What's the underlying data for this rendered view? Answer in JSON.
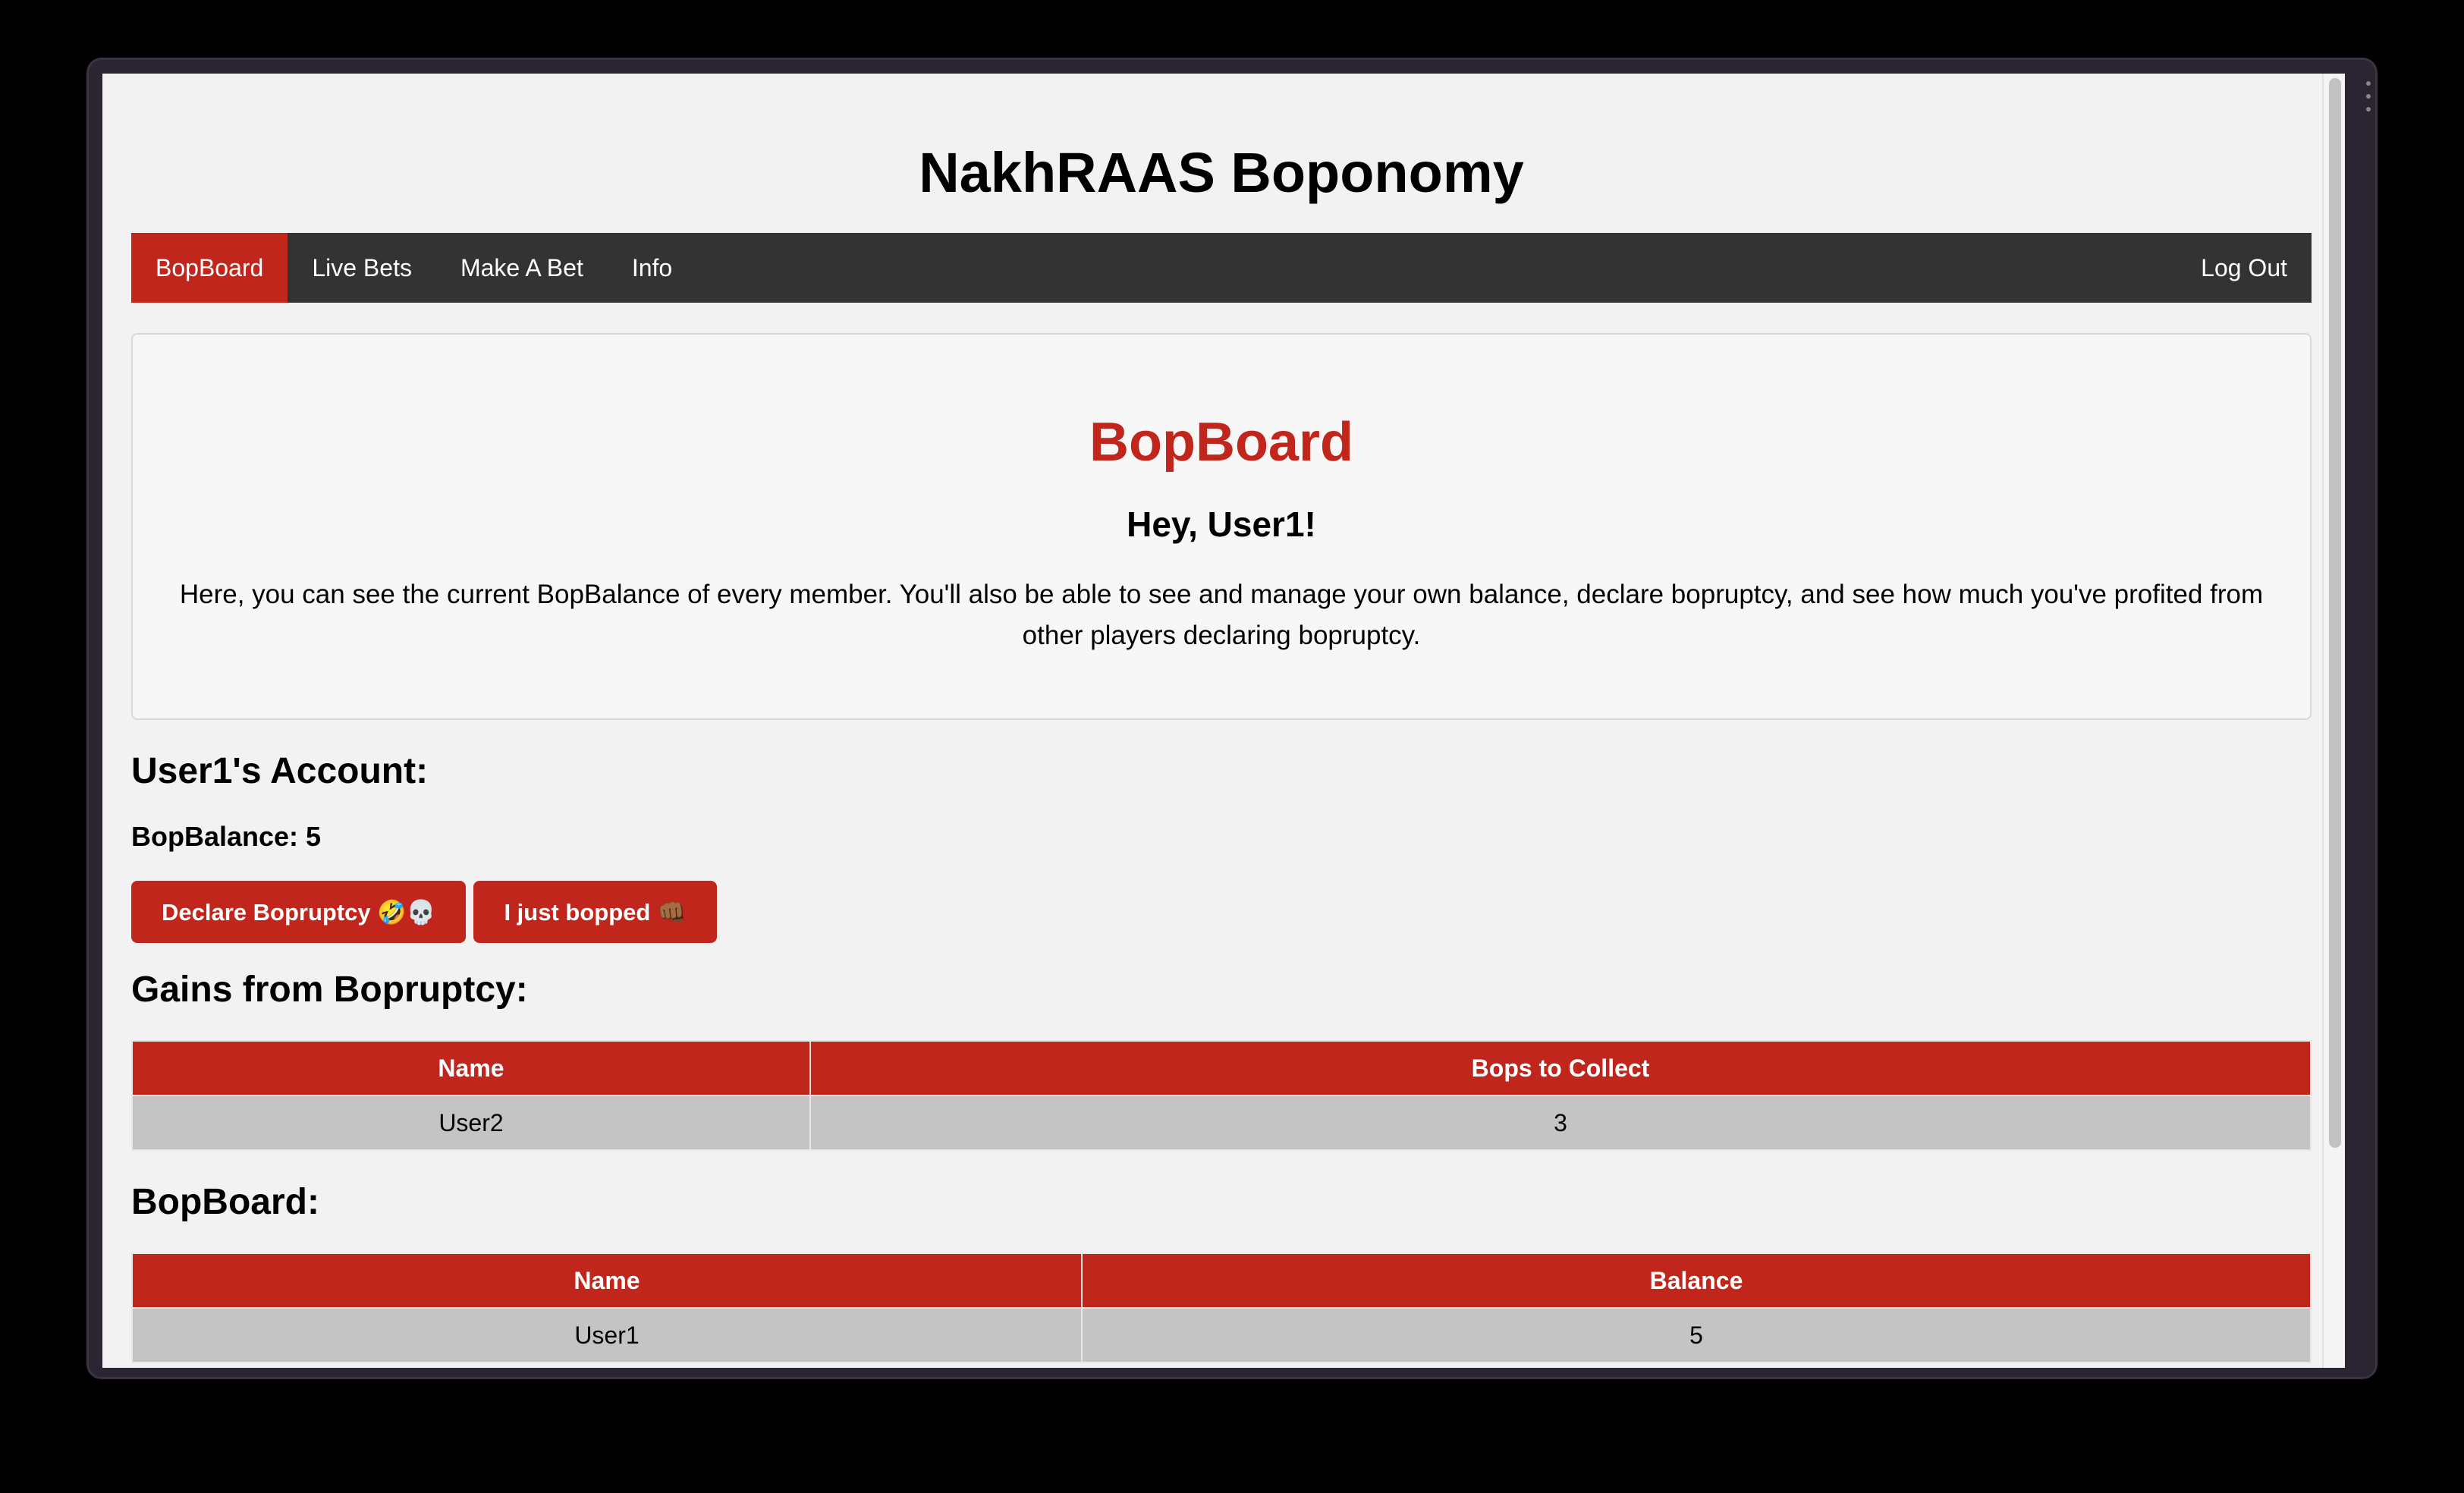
{
  "site": {
    "title": "NakhRAAS Boponomy"
  },
  "nav": {
    "items": [
      "BopBoard",
      "Live Bets",
      "Make A Bet",
      "Info"
    ],
    "logout": "Log Out"
  },
  "intro": {
    "heading": "BopBoard",
    "greeting": "Hey, User1!",
    "text": "Here, you can see the current BopBalance of every member. You'll also be able to see and manage your own balance, declare bopruptcy, and see how much you've profited from other players declaring bopruptcy."
  },
  "account": {
    "title": "User1's Account:",
    "balance": "BopBalance: 5",
    "declare_button": "Declare Bopruptcy 🤣💀",
    "bopped_button": "I just bopped 👊🏾"
  },
  "gains": {
    "title": "Gains from Bopruptcy:",
    "headers": [
      "Name",
      "Bops to Collect"
    ],
    "rows": [
      [
        "User2",
        "3"
      ]
    ]
  },
  "board": {
    "title": "BopBoard:",
    "headers": [
      "Name",
      "Balance"
    ],
    "rows": [
      [
        "User1",
        "5"
      ]
    ]
  },
  "colors": {
    "accent": "#c0261c",
    "navbar": "#333333",
    "row": "#c4c4c4",
    "page_bg": "#f2f2f2"
  }
}
